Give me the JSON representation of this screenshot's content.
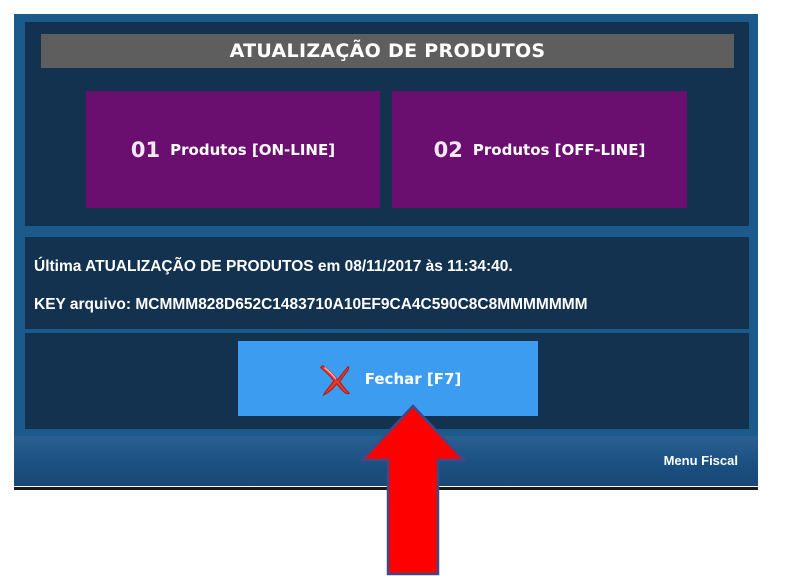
{
  "dialog": {
    "title": "ATUALIZAÇÃO DE PRODUTOS",
    "options": [
      {
        "number": "01",
        "label": "Produtos [ON-LINE]"
      },
      {
        "number": "02",
        "label": "Produtos [OFF-LINE]"
      }
    ],
    "info": {
      "last_update": "Última ATUALIZAÇÃO DE PRODUTOS em 08/11/2017 às 11:34:40.",
      "key_line": "KEY arquivo:  MCMMM828D652C1483710A10EF9CA4C590C8C8MMMMMMM"
    },
    "close_button": {
      "label": "Fechar [F7]",
      "icon": "x-close-icon"
    },
    "footer": {
      "label": "Menu Fiscal"
    }
  },
  "annotation": {
    "icon": "red-up-arrow",
    "color": "#ff0000"
  },
  "colors": {
    "dialog_background": "#1d5a8c",
    "panel_background": "#13324f",
    "title_bar": "#5e5e5e",
    "option_tile": "#6a0f70",
    "close_button": "#3b9cf0"
  }
}
